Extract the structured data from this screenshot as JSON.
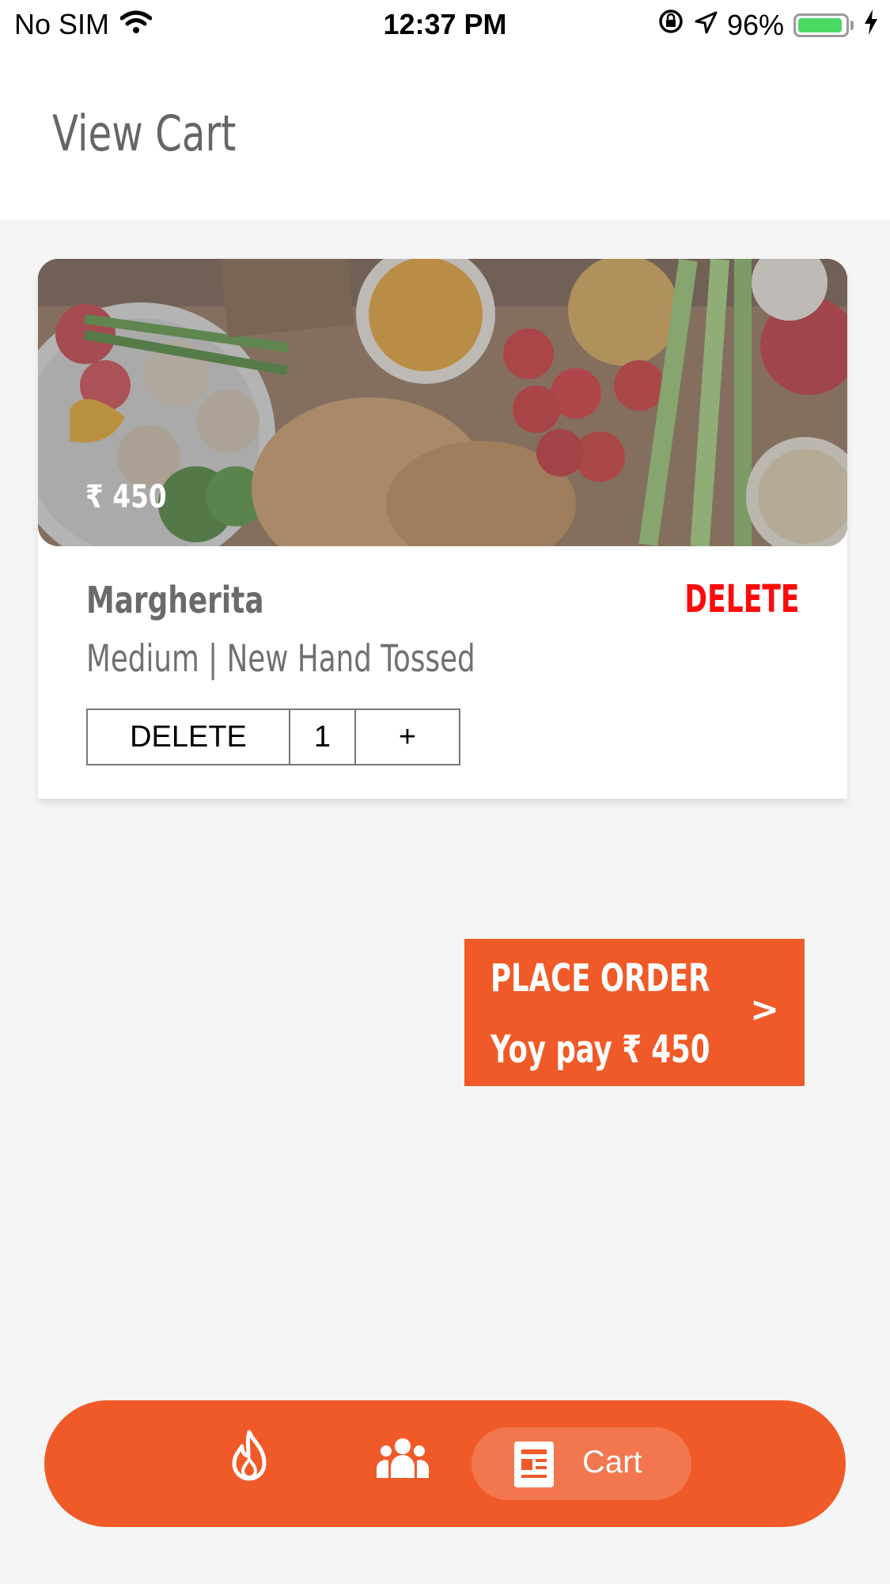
{
  "status_bar": {
    "carrier": "No SIM",
    "time": "12:37 PM",
    "battery_percent": "96%",
    "battery_level": 0.96,
    "icons": [
      "wifi-icon",
      "rotation-lock-icon",
      "location-arrow-icon",
      "battery-icon",
      "charging-bolt-icon"
    ]
  },
  "header": {
    "title": "View Cart"
  },
  "cart_item": {
    "image": "grocery-food-photo",
    "price": "₹  450",
    "name": "Margherita",
    "delete_label": "DELETE",
    "options": "Medium | New Hand Tossed",
    "quantity": {
      "decrement_label": "DELETE",
      "value": "1",
      "increment_label": "+"
    }
  },
  "place_order": {
    "title": "PLACE ORDER",
    "amount_text": "Yoy pay ₹ 450",
    "arrow": ">"
  },
  "bottom_nav": {
    "items": [
      {
        "icon": "fire-icon",
        "label": ""
      },
      {
        "icon": "team-icon",
        "label": ""
      },
      {
        "icon": "receipt-icon",
        "label": "Cart",
        "active": true
      }
    ]
  },
  "colors": {
    "accent": "#f05a28",
    "delete_red": "#ff0a0a",
    "background": "#f5f5f5",
    "text_gray": "#6a6a6a"
  }
}
